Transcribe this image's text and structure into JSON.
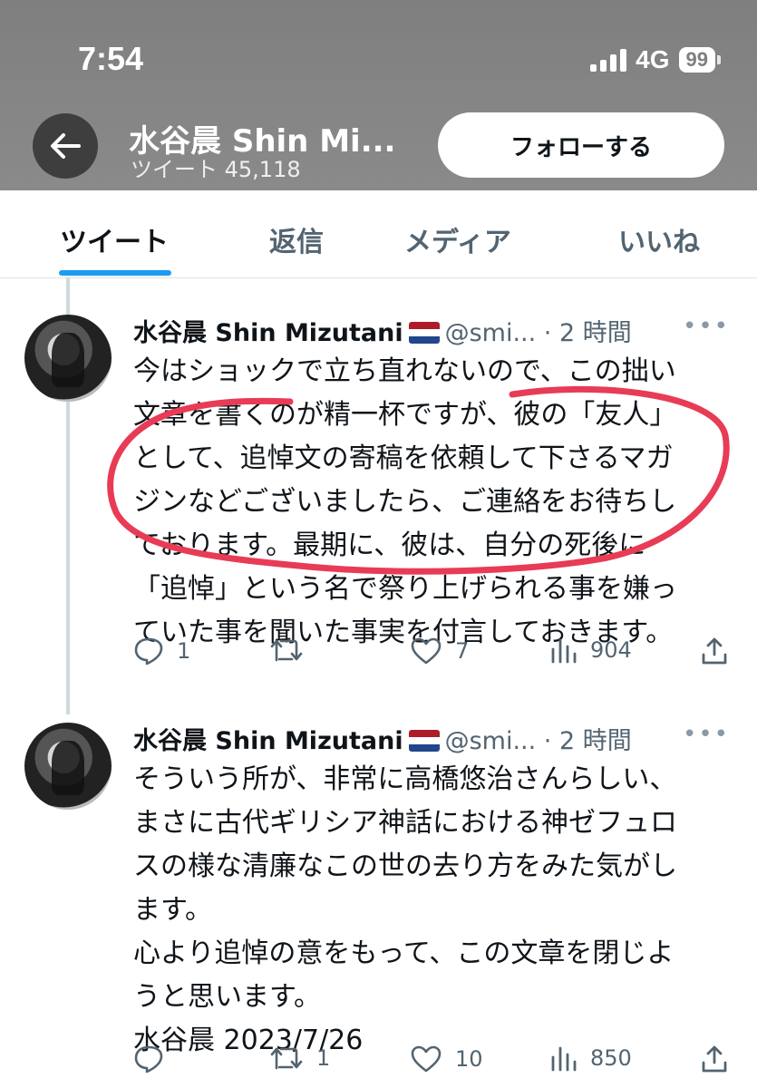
{
  "status_bar": {
    "time": "7:54",
    "network": "4G",
    "battery": "99"
  },
  "header": {
    "title": "水谷晨 Shin Mi...",
    "tweet_count": "ツイート 45,118",
    "follow_label": "フォローする"
  },
  "tabs": [
    {
      "label": "ツイート",
      "active": true
    },
    {
      "label": "返信",
      "active": false
    },
    {
      "label": "メディア",
      "active": false
    },
    {
      "label": "いいね",
      "active": false
    }
  ],
  "tweets": [
    {
      "name": "水谷晨 Shin Mizutani",
      "meta": "@smi... · 2 時間",
      "lines": [
        "今はショックで立ち直れないので、この拙い",
        "文章を書くのが精一杯ですが、彼の「友人」",
        "として、追悼文の寄稿を依頼して下さるマガ",
        "ジンなどございましたら、ご連絡をお待ちし",
        "ております。最期に、彼は、自分の死後に",
        "「追悼」という名で祭り上げられる事を嫌っ",
        "ていた事を聞いた事実を付言しておきます。"
      ],
      "replies": "1",
      "retweets": "",
      "likes": "7",
      "views": "904"
    },
    {
      "name": "水谷晨 Shin Mizutani",
      "meta": "@smi... · 2 時間",
      "lines": [
        "そういう所が、非常に高橋悠治さんらしい、",
        "まさに古代ギリシア神話における神ゼフュロ",
        "スの様な清廉なこの世の去り方をみた気がし",
        "ます。",
        "心より追悼の意をもって、この文章を閉じよ",
        "うと思います。",
        "水谷晨 2023/7/26"
      ],
      "replies": "",
      "retweets": "1",
      "likes": "10",
      "views": "850"
    }
  ],
  "colors": {
    "accent": "#1d9bf0",
    "annotation": "#e83b55",
    "banner": "#858585"
  }
}
